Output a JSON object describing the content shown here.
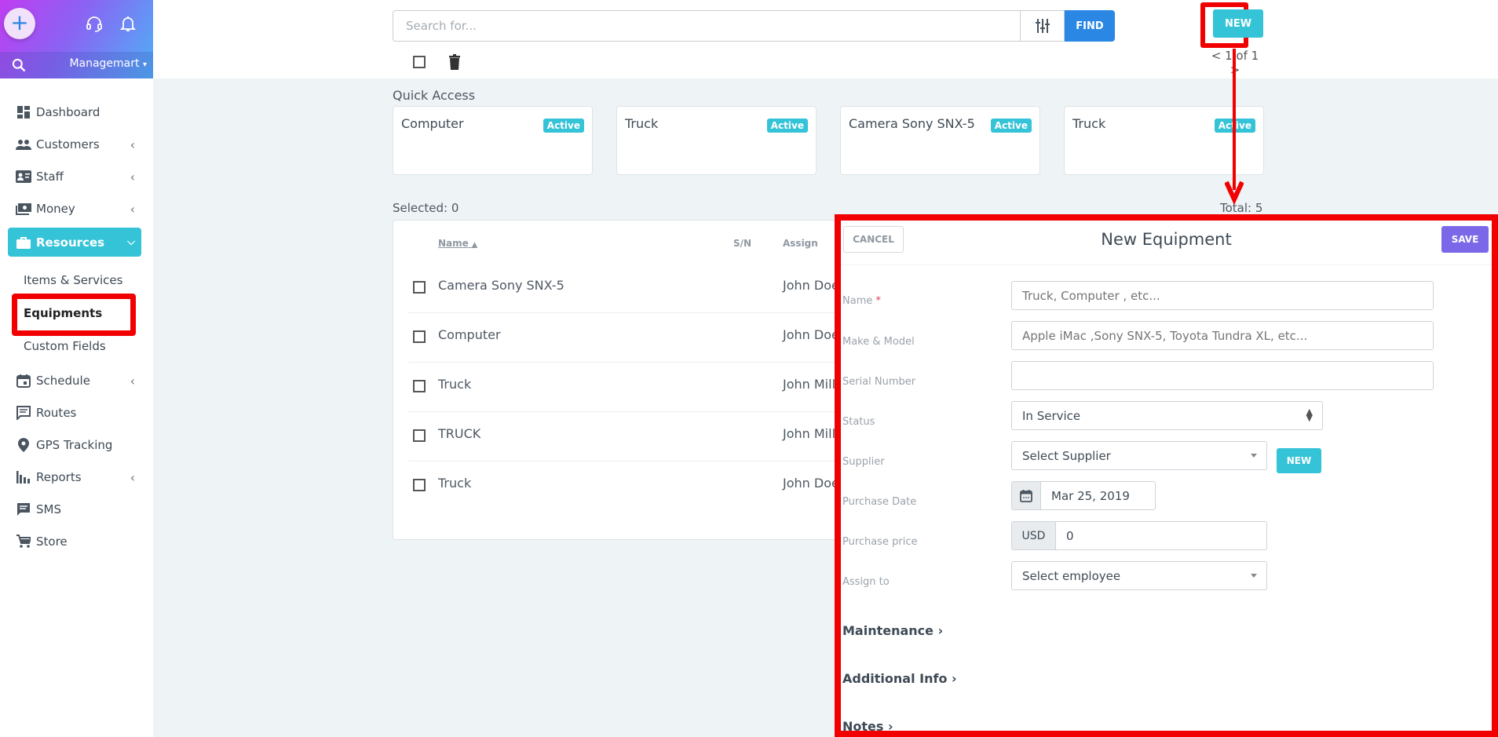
{
  "sidebar": {
    "org_name": "Managemart",
    "nav": [
      {
        "label": "Dashboard",
        "icon": "dashboard-icon",
        "has_chevron": false
      },
      {
        "label": "Customers",
        "icon": "customers-icon",
        "has_chevron": true
      },
      {
        "label": "Staff",
        "icon": "staff-icon",
        "has_chevron": true
      },
      {
        "label": "Money",
        "icon": "money-icon",
        "has_chevron": true
      },
      {
        "label": "Resources",
        "icon": "briefcase-icon",
        "active": true,
        "expanded": true
      },
      {
        "label": "Schedule",
        "icon": "calendar-icon",
        "has_chevron": true
      },
      {
        "label": "Routes",
        "icon": "routes-icon",
        "has_chevron": false
      },
      {
        "label": "GPS Tracking",
        "icon": "location-pin-icon",
        "has_chevron": false
      },
      {
        "label": "Reports",
        "icon": "bar-chart-icon",
        "has_chevron": true
      },
      {
        "label": "SMS",
        "icon": "sms-icon",
        "has_chevron": false
      },
      {
        "label": "Store",
        "icon": "cart-icon",
        "has_chevron": false
      }
    ],
    "resources_sub": [
      {
        "label": "Items & Services"
      },
      {
        "label": "Equipments",
        "active": true
      },
      {
        "label": "Custom Fields"
      }
    ]
  },
  "toolbar": {
    "search_placeholder": "Search for...",
    "find_label": "FIND",
    "new_label": "NEW",
    "pager": "< 1 of 1 >"
  },
  "quick_access": {
    "label": "Quick Access",
    "cards": [
      {
        "title": "Computer",
        "status": "Active"
      },
      {
        "title": "Truck",
        "status": "Active"
      },
      {
        "title": "Camera Sony SNX-5",
        "status": "Active"
      },
      {
        "title": "Truck",
        "status": "Active"
      }
    ]
  },
  "list": {
    "selected": "Selected: 0",
    "total": "Total: 5",
    "columns": [
      "Name",
      "S/N",
      "Assign"
    ],
    "rows": [
      {
        "name": "Camera Sony SNX-5",
        "sn": "",
        "assign": "John Doe"
      },
      {
        "name": "Computer",
        "sn": "",
        "assign": "John Doe"
      },
      {
        "name": "Truck",
        "sn": "",
        "assign": "John Miller"
      },
      {
        "name": "TRUCK",
        "sn": "",
        "assign": "John Miller"
      },
      {
        "name": "Truck",
        "sn": "",
        "assign": "John Doe"
      }
    ]
  },
  "panel": {
    "title": "New Equipment",
    "cancel_label": "CANCEL",
    "save_label": "SAVE",
    "fields": {
      "name_label": "Name",
      "name_required": "*",
      "name_placeholder": "Truck, Computer , etc...",
      "make_label": "Make & Model",
      "make_placeholder": "Apple iMac ,Sony SNX-5, Toyota Tundra XL, etc...",
      "serial_label": "Serial Number",
      "serial_value": "",
      "status_label": "Status",
      "status_value": "In Service",
      "supplier_label": "Supplier",
      "supplier_value": "Select Supplier",
      "supplier_new_label": "NEW",
      "date_label": "Purchase Date",
      "date_value": "Mar 25, 2019",
      "price_label": "Purchase price",
      "price_currency": "USD",
      "price_value": "0",
      "assign_label": "Assign to",
      "assign_value": "Select employee"
    },
    "sections": [
      "Maintenance",
      "Additional Info",
      "Notes"
    ]
  },
  "colors": {
    "accent": "#35c3d8",
    "find": "#2a88e4",
    "save": "#7b68e8",
    "highlight": "#f20000"
  }
}
